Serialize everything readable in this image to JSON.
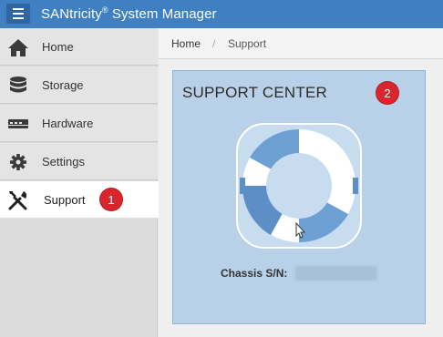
{
  "header": {
    "app_name": "SANtricity",
    "registered_mark": "®",
    "app_suffix": " System Manager",
    "menu_icon": "hamburger-icon"
  },
  "sidebar": {
    "items": [
      {
        "label": "Home",
        "icon": "home-icon"
      },
      {
        "label": "Storage",
        "icon": "database-icon"
      },
      {
        "label": "Hardware",
        "icon": "hardware-icon"
      },
      {
        "label": "Settings",
        "icon": "gear-icon"
      },
      {
        "label": "Support",
        "icon": "tools-icon",
        "active": true
      }
    ],
    "support_callout": "1"
  },
  "breadcrumb": {
    "home": "Home",
    "separator": "/",
    "current": "Support"
  },
  "support_card": {
    "title": "SUPPORT CENTER",
    "callout": "2",
    "icon": "life-ring-icon",
    "chassis_label": "Chassis S/N:",
    "chassis_value": ""
  },
  "colors": {
    "header_bg": "#3f80c2",
    "card_bg": "#b9d1e8",
    "callout_red": "#d9262c"
  }
}
